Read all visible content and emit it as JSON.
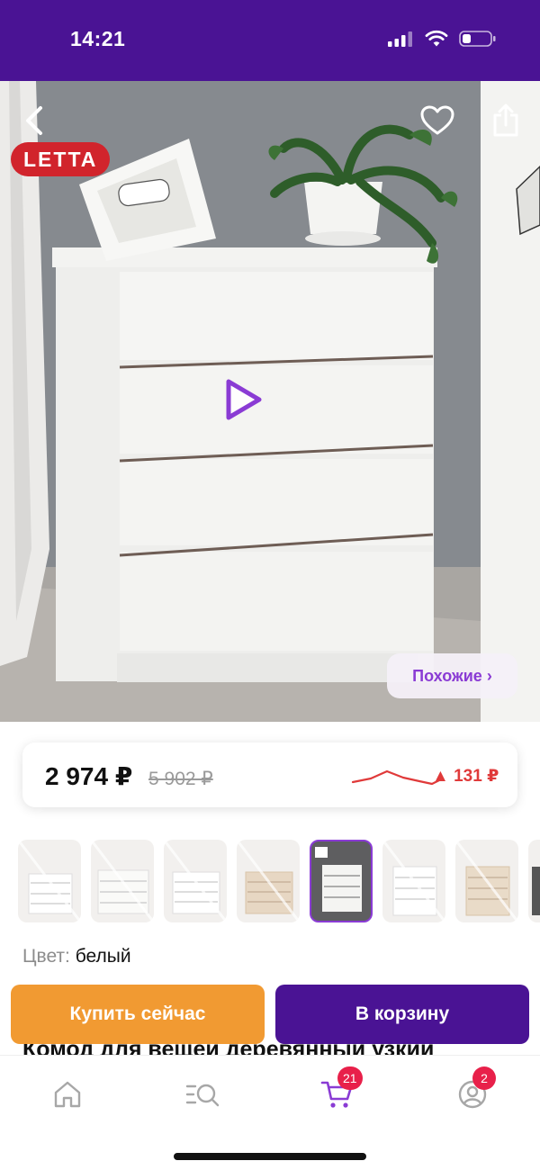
{
  "status_bar": {
    "time": "14:21"
  },
  "gallery": {
    "brand_badge": "LETTA",
    "similar_button": "Похожие ›"
  },
  "price": {
    "current": "2 974 ₽",
    "old": "5 902 ₽",
    "change": "▲ 131 ₽"
  },
  "color": {
    "label": "Цвет:",
    "value": "белый"
  },
  "product_title_partial": "Комод для вещей деревянный узкий",
  "actions": {
    "buy_now": "Купить сейчас",
    "add_to_cart": "В корзину"
  },
  "tabbar": {
    "cart_badge": "21",
    "profile_badge": "2"
  },
  "colors": {
    "brand_purple": "#4a1394",
    "accent_purple": "#8a3bd4",
    "buy_orange": "#f19a32",
    "price_up_red": "#e03a3a",
    "badge_red": "#e8204a"
  }
}
